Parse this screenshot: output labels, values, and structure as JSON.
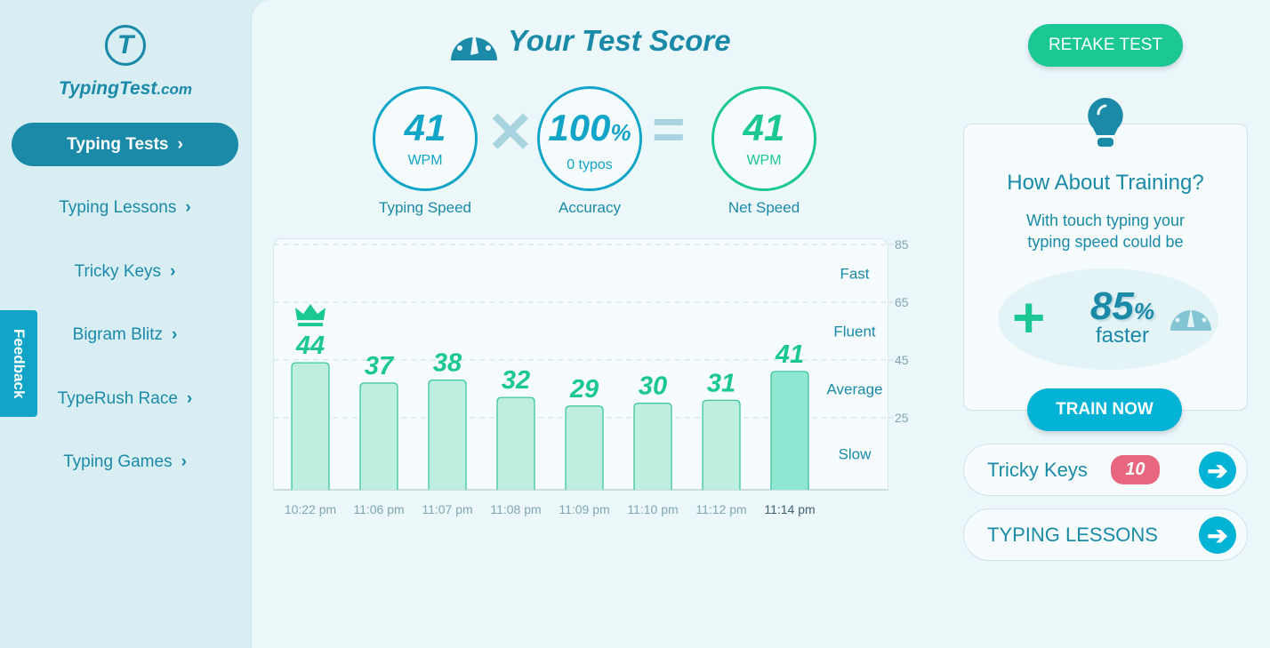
{
  "brand": {
    "name": "TypingTest",
    "suffix": ".com",
    "mark": "T"
  },
  "nav": [
    {
      "label": "Typing Tests",
      "active": true
    },
    {
      "label": "Typing Lessons"
    },
    {
      "label": "Tricky Keys"
    },
    {
      "label": "Bigram Blitz"
    },
    {
      "label": "TypeRush Race"
    },
    {
      "label": "Typing Games"
    }
  ],
  "feedback": "Feedback",
  "header": {
    "title": "Your Test Score",
    "retake": "RETAKE TEST"
  },
  "scores": {
    "speed": {
      "value": "41",
      "unit": "WPM",
      "label": "Typing Speed"
    },
    "accuracy": {
      "value": "100",
      "unit": "%",
      "sub": "0 typos",
      "label": "Accuracy"
    },
    "net": {
      "value": "41",
      "unit": "WPM",
      "label": "Net Speed"
    },
    "times_sign": "✕",
    "equals_sign": "="
  },
  "chart_data": {
    "type": "bar",
    "categories": [
      "10:22 pm",
      "11:06 pm",
      "11:07 pm",
      "11:08 pm",
      "11:09 pm",
      "11:10 pm",
      "11:12 pm",
      "11:14 pm"
    ],
    "values": [
      44,
      37,
      38,
      32,
      29,
      30,
      31,
      41
    ],
    "ylim": [
      0,
      85
    ],
    "yticks": [
      25,
      45,
      65,
      85
    ],
    "bands": [
      "Slow",
      "Average",
      "Fluent",
      "Fast"
    ],
    "grid": true,
    "best_index": 0,
    "current_index": 7,
    "colors": {
      "bar": "#bdeee0",
      "current": "#8fe6d1",
      "stroke": "#3cc79c",
      "label": "#1bc793"
    }
  },
  "training": {
    "title": "How About Training?",
    "line1": "With touch typing your",
    "line2": "typing speed could be",
    "value": "85",
    "unit": "%",
    "faster": "faster",
    "plus": "+",
    "button": "TRAIN NOW"
  },
  "links": {
    "tricky": {
      "label": "Tricky Keys",
      "badge": "10"
    },
    "lessons": {
      "label": "TYPING LESSONS"
    }
  }
}
